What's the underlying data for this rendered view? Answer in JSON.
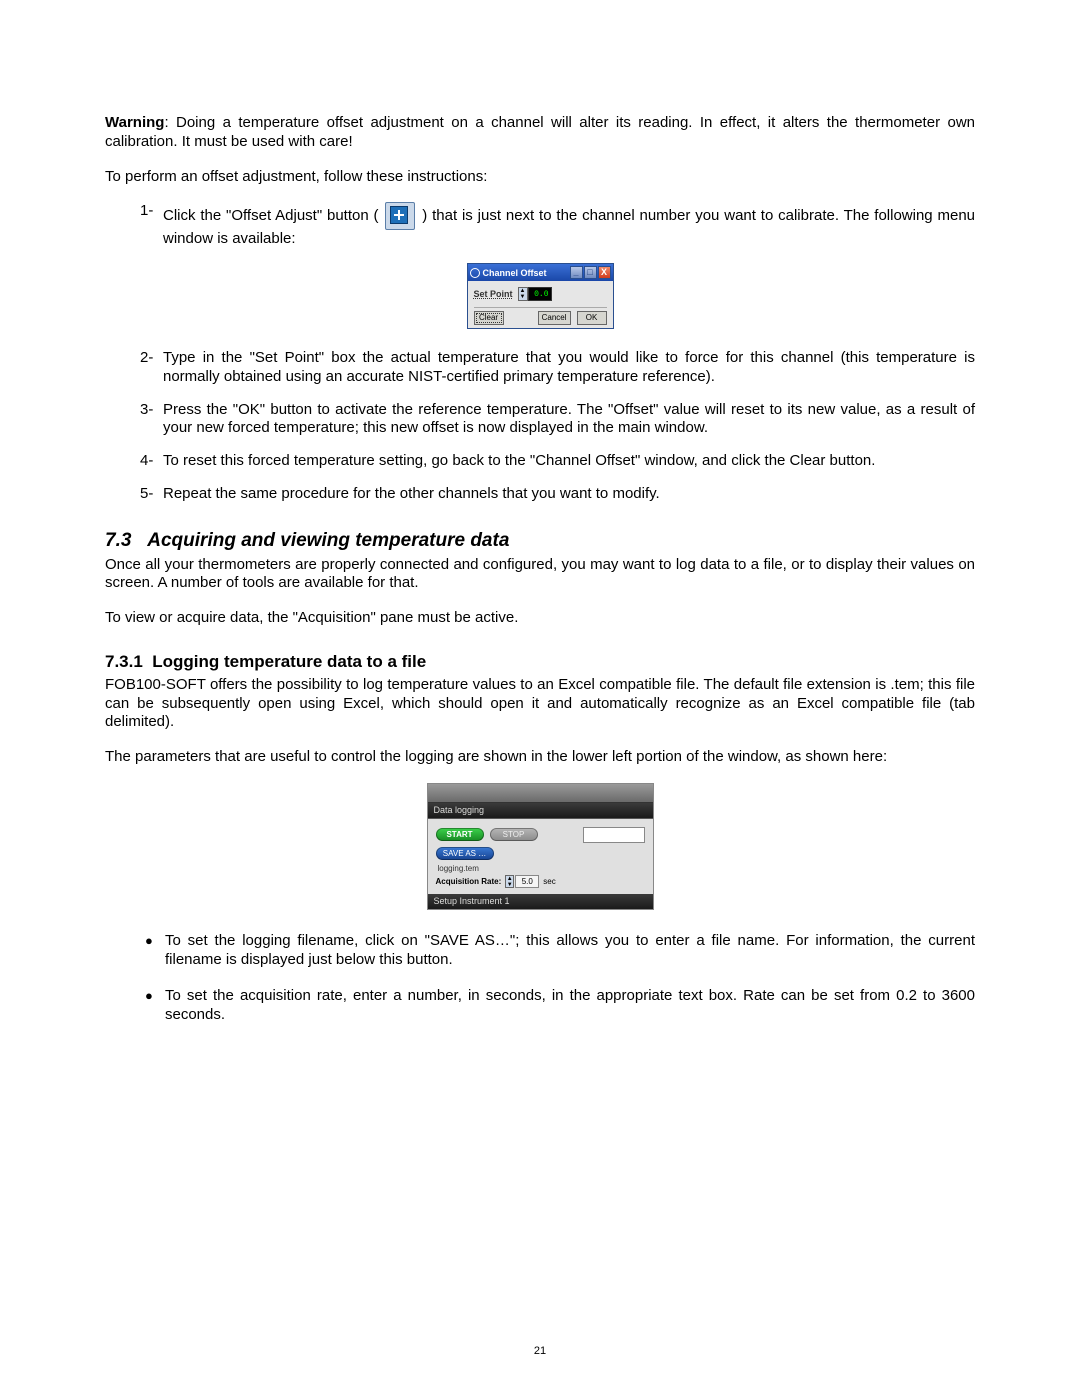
{
  "warning": {
    "label": "Warning",
    "text": ": Doing a temperature offset adjustment on a channel will alter its reading. In effect, it alters the thermometer own calibration. It must be used with care!"
  },
  "intro_instructions": "To perform an offset adjustment, follow these instructions:",
  "steps": {
    "s1": {
      "marker": "1-",
      "text_a": "Click the \"Offset Adjust\" button ( ",
      "text_b": " ) that is just next to the channel number you want to calibrate. The following menu window is available:"
    },
    "s2": {
      "marker": "2-",
      "text": "Type in the \"Set Point\" box the actual temperature that you would like to force for this channel (this temperature is normally obtained using an accurate NIST-certified primary temperature reference)."
    },
    "s3": {
      "marker": "3-",
      "text": "Press the \"OK\" button to activate the reference temperature. The \"Offset\" value will reset to its new value, as a result of your new forced temperature; this new offset is now displayed in the main window."
    },
    "s4": {
      "marker": "4-",
      "text": "To reset this forced temperature setting, go back to the \"Channel Offset\" window, and click the Clear button."
    },
    "s5": {
      "marker": "5-",
      "text": "Repeat the same procedure for the other channels that you want to modify."
    }
  },
  "section73": {
    "number": "7.3",
    "title": "Acquiring and viewing temperature data",
    "p1": "Once all your thermometers are properly connected and configured, you may want to log data to a file, or to display their values on screen. A number of tools are available for that.",
    "p2": "To view or acquire data, the \"Acquisition\" pane must be active."
  },
  "section731": {
    "number": "7.3.1",
    "title": "Logging temperature data to a file",
    "p1": "FOB100-SOFT offers the possibility to log temperature values to an Excel compatible file. The default file extension is .tem; this file can be subsequently open using Excel, which should open it and automatically recognize as an Excel compatible file (tab delimited).",
    "p2": "The parameters that are useful to control the logging are shown in the lower left portion of the window, as shown here:"
  },
  "bullets": {
    "b1": "To set the logging filename, click on \"SAVE AS…\"; this allows you to enter a file name. For information, the current filename is displayed just below this button.",
    "b2": "To set the acquisition rate, enter a number, in seconds, in the appropriate text box. Rate can be set from 0.2 to 3600 seconds."
  },
  "channel_offset_window": {
    "title": "Channel Offset",
    "minimize": "_",
    "maximize": "□",
    "close": "X",
    "setpoint_label": "Set Point",
    "setpoint_value": "0.0",
    "clear": "Clear",
    "cancel": "Cancel",
    "ok": "OK"
  },
  "datalogging_panel": {
    "header": "Data logging",
    "start": "START",
    "stop": "STOP",
    "saveas": "SAVE AS …",
    "filename": "logging.tem",
    "acq_label": "Acquisition Rate:",
    "acq_value": "5.0",
    "acq_unit": "sec",
    "footer": "Setup Instrument 1"
  },
  "page_number": "21",
  "icons": {
    "offset_adjust": "plus-icon"
  }
}
